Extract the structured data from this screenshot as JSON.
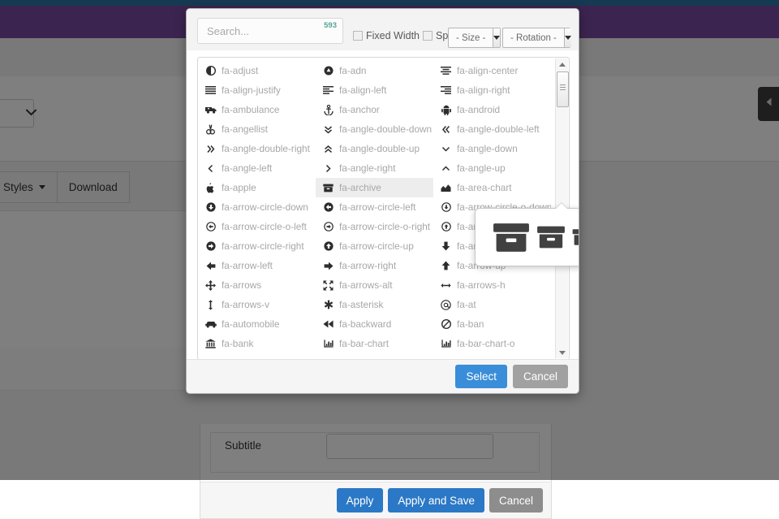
{
  "background": {
    "topstrip_color": "#163a52",
    "navbar_color": "#3c2450",
    "toolbar": {
      "styles_label": "Styles",
      "download_label": "Download"
    },
    "form": {
      "subtitle_label": "Subtitle",
      "subtitle_value": "",
      "apply_label": "Apply",
      "apply_and_save_label": "Apply and Save",
      "cancel_label": "Cancel"
    },
    "edge_tab_icon": "chevron-left-icon"
  },
  "modal": {
    "search": {
      "placeholder": "Search...",
      "value": "",
      "result_count": "593",
      "count_color": "#56a396"
    },
    "options": {
      "fixed_width_label": "Fixed Width",
      "fixed_width_checked": false,
      "spinning_label": "Spinning",
      "spinning_checked": false,
      "size_label": "- Size -",
      "rotation_label": "- Rotation -"
    },
    "footer": {
      "select_label": "Select",
      "select_color": "#3a8dd8",
      "cancel_label": "Cancel",
      "cancel_color": "#a1a1a1"
    },
    "selected_icon": "fa-archive",
    "popover": {
      "icon": "archive-icon",
      "sizes": [
        46,
        36,
        26,
        18,
        12
      ]
    },
    "icons": [
      {
        "name": "fa-adjust",
        "glyph": "adjust-icon"
      },
      {
        "name": "fa-adn",
        "glyph": "adn-icon"
      },
      {
        "name": "fa-align-center",
        "glyph": "align-center-icon"
      },
      {
        "name": "fa-align-justify",
        "glyph": "align-justify-icon"
      },
      {
        "name": "fa-align-left",
        "glyph": "align-left-icon"
      },
      {
        "name": "fa-align-right",
        "glyph": "align-right-icon"
      },
      {
        "name": "fa-ambulance",
        "glyph": "ambulance-icon"
      },
      {
        "name": "fa-anchor",
        "glyph": "anchor-icon"
      },
      {
        "name": "fa-android",
        "glyph": "android-icon"
      },
      {
        "name": "fa-angellist",
        "glyph": "angellist-icon"
      },
      {
        "name": "fa-angle-double-down",
        "glyph": "angle-double-down-icon"
      },
      {
        "name": "fa-angle-double-left",
        "glyph": "angle-double-left-icon"
      },
      {
        "name": "fa-angle-double-right",
        "glyph": "angle-double-right-icon"
      },
      {
        "name": "fa-angle-double-up",
        "glyph": "angle-double-up-icon"
      },
      {
        "name": "fa-angle-down",
        "glyph": "angle-down-icon"
      },
      {
        "name": "fa-angle-left",
        "glyph": "angle-left-icon"
      },
      {
        "name": "fa-angle-right",
        "glyph": "angle-right-icon"
      },
      {
        "name": "fa-angle-up",
        "glyph": "angle-up-icon"
      },
      {
        "name": "fa-apple",
        "glyph": "apple-icon"
      },
      {
        "name": "fa-archive",
        "glyph": "archive-icon"
      },
      {
        "name": "fa-area-chart",
        "glyph": "area-chart-icon"
      },
      {
        "name": "fa-arrow-circle-down",
        "glyph": "arrow-circle-down-icon"
      },
      {
        "name": "fa-arrow-circle-left",
        "glyph": "arrow-circle-left-icon"
      },
      {
        "name": "fa-arrow-circle-o-down",
        "glyph": "arrow-circle-o-down-icon"
      },
      {
        "name": "fa-arrow-circle-o-left",
        "glyph": "arrow-circle-o-left-icon"
      },
      {
        "name": "fa-arrow-circle-o-right",
        "glyph": "arrow-circle-o-right-icon"
      },
      {
        "name": "fa-arrow-circle-o-up",
        "glyph": "arrow-circle-o-up-icon"
      },
      {
        "name": "fa-arrow-circle-right",
        "glyph": "arrow-circle-right-icon"
      },
      {
        "name": "fa-arrow-circle-up",
        "glyph": "arrow-circle-up-icon"
      },
      {
        "name": "fa-arrow-down",
        "glyph": "arrow-down-icon"
      },
      {
        "name": "fa-arrow-left",
        "glyph": "arrow-left-icon"
      },
      {
        "name": "fa-arrow-right",
        "glyph": "arrow-right-icon"
      },
      {
        "name": "fa-arrow-up",
        "glyph": "arrow-up-icon"
      },
      {
        "name": "fa-arrows",
        "glyph": "arrows-icon"
      },
      {
        "name": "fa-arrows-alt",
        "glyph": "arrows-alt-icon"
      },
      {
        "name": "fa-arrows-h",
        "glyph": "arrows-h-icon"
      },
      {
        "name": "fa-arrows-v",
        "glyph": "arrows-v-icon"
      },
      {
        "name": "fa-asterisk",
        "glyph": "asterisk-icon"
      },
      {
        "name": "fa-at",
        "glyph": "at-icon"
      },
      {
        "name": "fa-automobile",
        "glyph": "automobile-icon"
      },
      {
        "name": "fa-backward",
        "glyph": "backward-icon"
      },
      {
        "name": "fa-ban",
        "glyph": "ban-icon"
      },
      {
        "name": "fa-bank",
        "glyph": "bank-icon"
      },
      {
        "name": "fa-bar-chart",
        "glyph": "bar-chart-icon"
      },
      {
        "name": "fa-bar-chart-o",
        "glyph": "bar-chart-o-icon"
      }
    ],
    "display_order": [
      "fa-adjust",
      "fa-adn",
      "fa-align-center",
      "fa-align-justify",
      "fa-align-left",
      "fa-align-right",
      "fa-ambulance",
      "fa-anchor",
      "fa-android",
      "fa-angellist",
      "fa-angle-double-down",
      "fa-angle-double-left",
      "fa-angle-double-right",
      "fa-angle-double-up",
      "fa-angle-down",
      "fa-angle-left",
      "fa-angle-right",
      "fa-angle-up",
      "fa-apple",
      "fa-archive",
      "fa-area-chart",
      "fa-arrow-circle-down",
      "fa-arrow-circle-left",
      "fa-arrow-circle-o-down",
      "fa-arrow-circle-o-left",
      "fa-arrow-circle-o-right",
      "fa-arrow-circle-o-up",
      "fa-arrow-circle-right",
      "fa-arrow-circle-up",
      "fa-arrow-down",
      "fa-arrow-left",
      "fa-arrow-right",
      "fa-arrow-up",
      "fa-arrows",
      "fa-arrows-alt",
      "fa-arrows-h",
      "fa-arrows-v",
      "fa-asterisk",
      "fa-at",
      "fa-automobile",
      "fa-backward",
      "fa-ban",
      "fa-bank",
      "fa-bar-chart",
      "fa-bar-chart-o"
    ]
  }
}
